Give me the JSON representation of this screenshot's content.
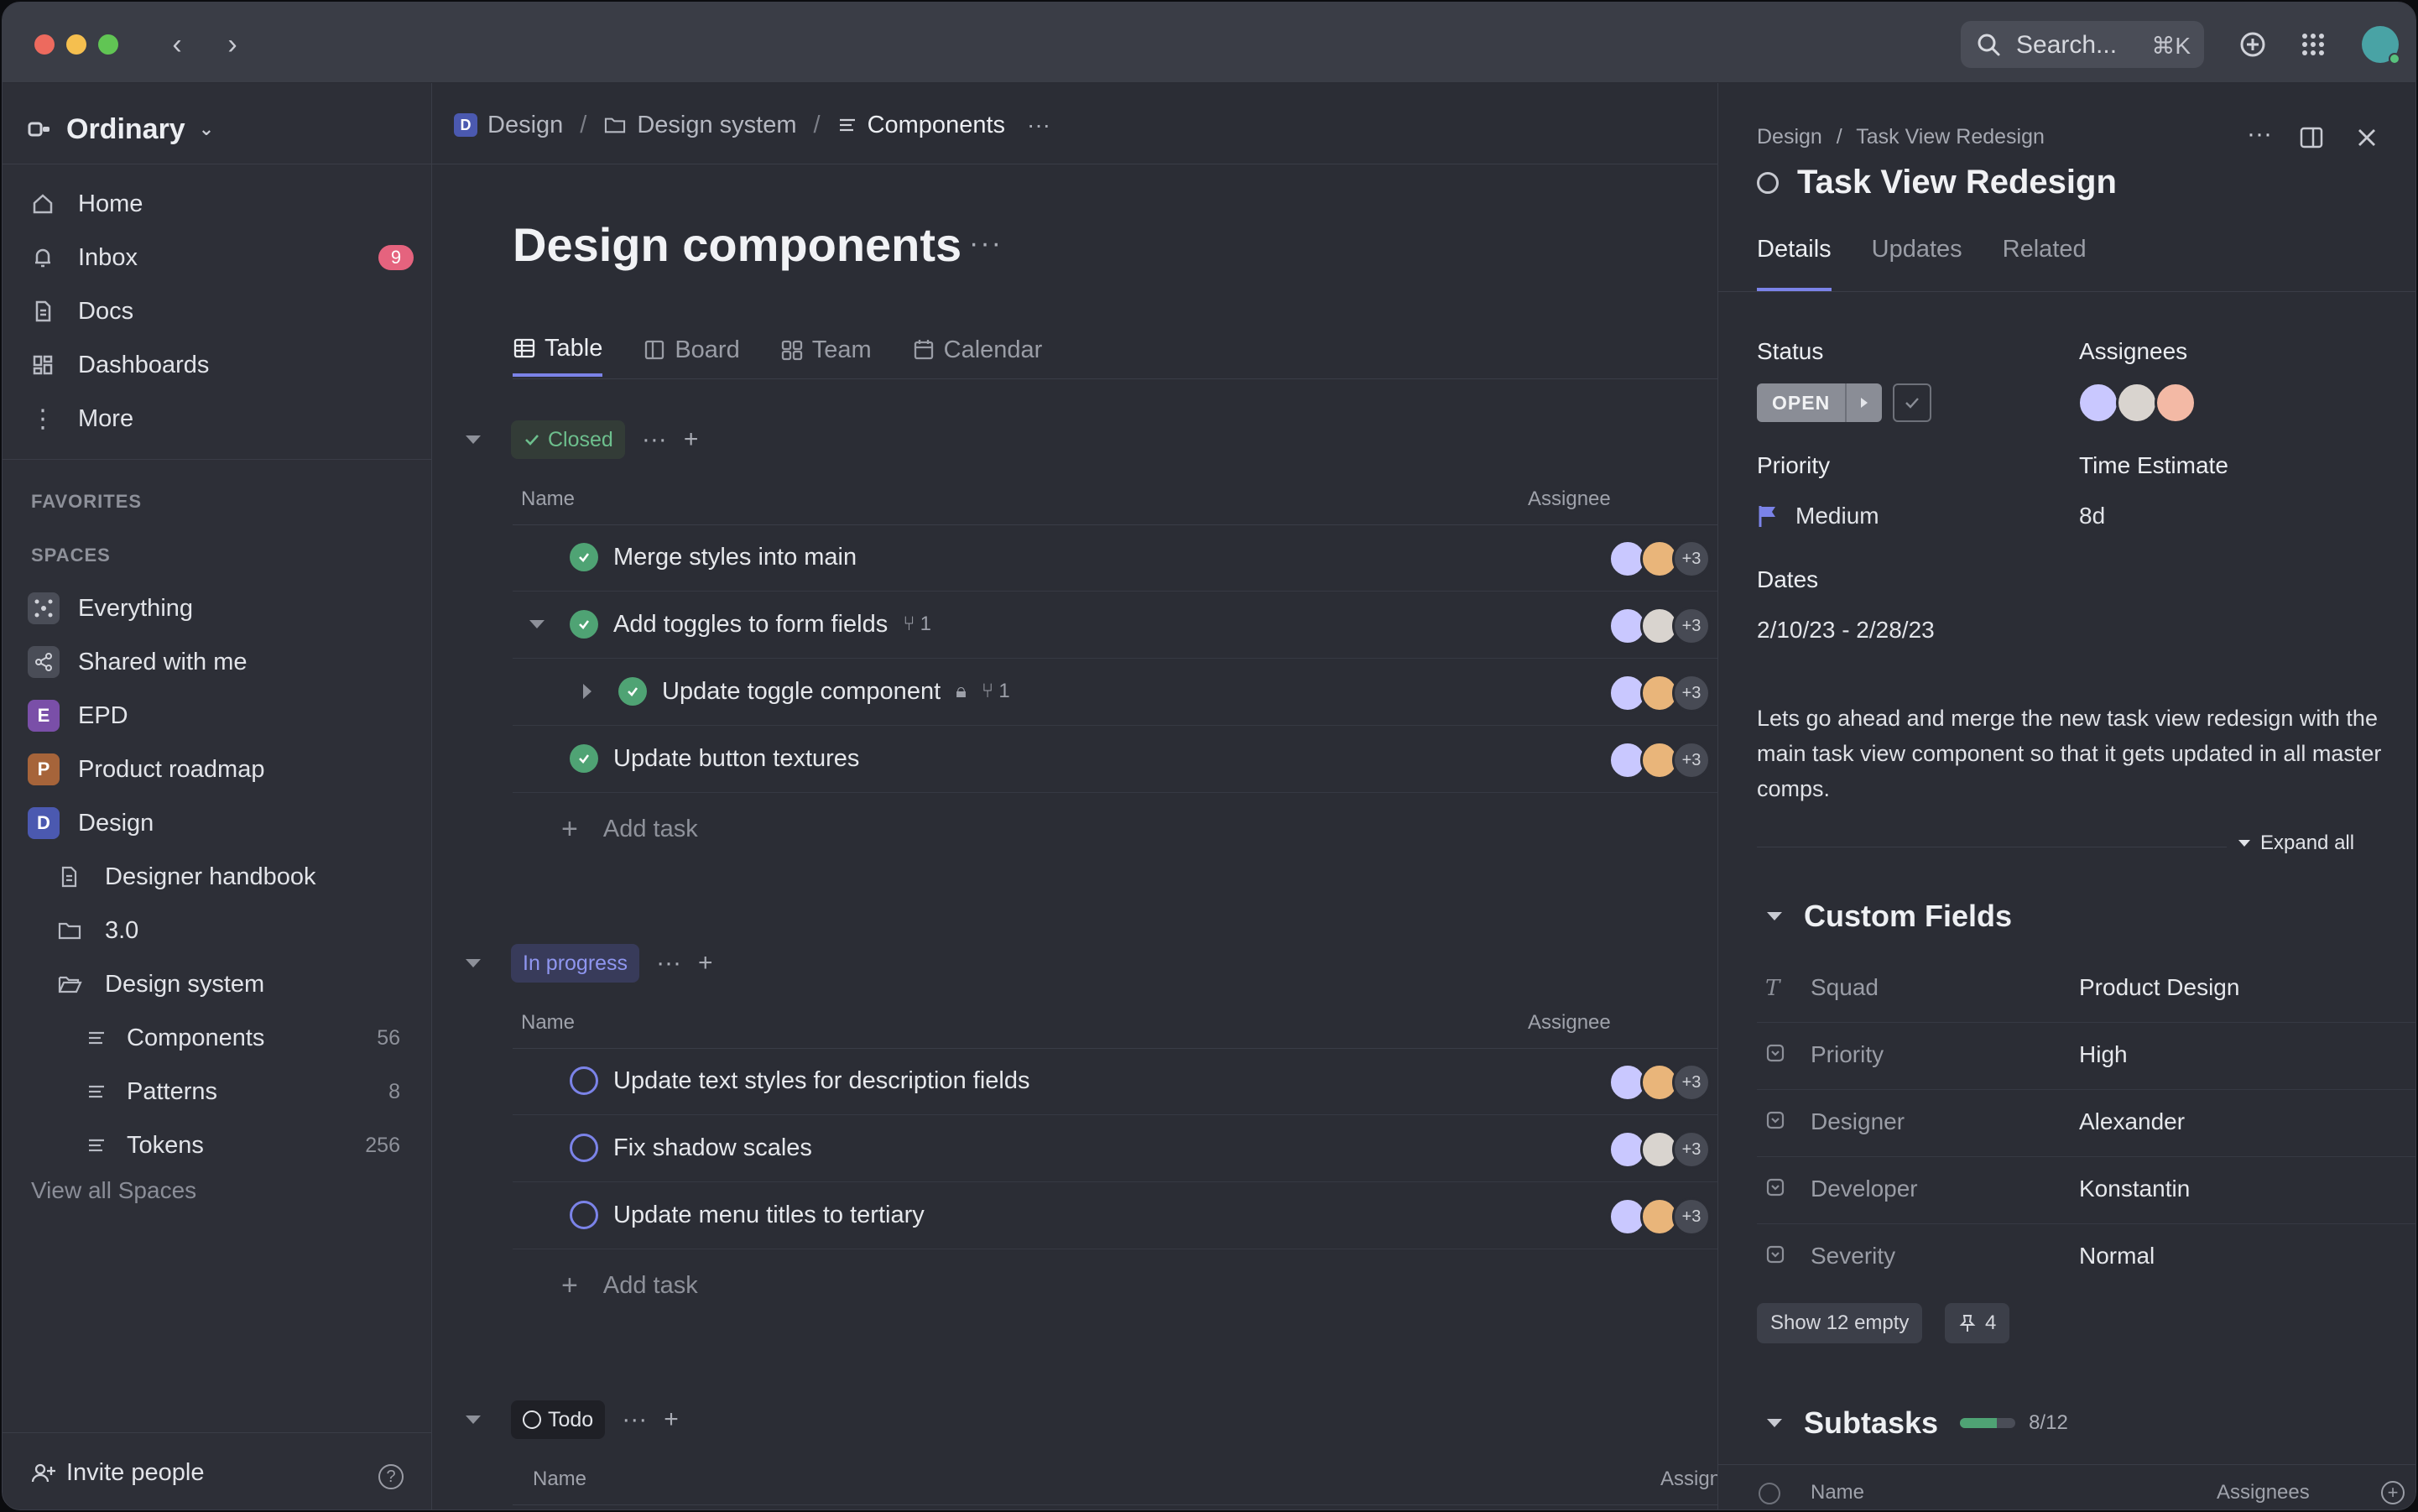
{
  "topbar": {
    "search_placeholder": "Search...",
    "search_shortcut": "⌘K"
  },
  "sidebar": {
    "workspace": "Ordinary",
    "nav": [
      {
        "label": "Home"
      },
      {
        "label": "Inbox",
        "badge": "9"
      },
      {
        "label": "Docs"
      },
      {
        "label": "Dashboards"
      },
      {
        "label": "More"
      }
    ],
    "favorites_label": "FAVORITES",
    "spaces_label": "SPACES",
    "spaces": [
      {
        "label": "Everything"
      },
      {
        "label": "Shared with me"
      },
      {
        "label": "EPD",
        "letter": "E",
        "color": "#7a4fa8"
      },
      {
        "label": "Product roadmap",
        "letter": "P",
        "color": "#a6643a"
      },
      {
        "label": "Design",
        "letter": "D",
        "color": "#4b59b0"
      }
    ],
    "design_children": [
      {
        "label": "Designer handbook"
      },
      {
        "label": "3.0"
      },
      {
        "label": "Design system"
      }
    ],
    "lists": [
      {
        "label": "Components",
        "count": "56"
      },
      {
        "label": "Patterns",
        "count": "8"
      },
      {
        "label": "Tokens",
        "count": "256"
      }
    ],
    "view_all": "View all Spaces",
    "invite": "Invite people"
  },
  "main": {
    "breadcrumb": [
      "Design",
      "Design system",
      "Components"
    ],
    "title": "Design components",
    "views": [
      "Table",
      "Board",
      "Team",
      "Calendar"
    ],
    "groups": {
      "closed": {
        "status": "Closed",
        "col_name": "Name",
        "col_assignee": "Assignee",
        "tasks": [
          {
            "name": "Merge styles into main"
          },
          {
            "name": "Add toggles to form fields",
            "subcount": "1"
          },
          {
            "name": "Update toggle component",
            "subcount": "1"
          },
          {
            "name": "Update button textures"
          }
        ],
        "add_task": "Add task"
      },
      "in_progress": {
        "status": "In progress",
        "col_name": "Name",
        "col_assignee": "Assignee",
        "tasks": [
          {
            "name": "Update text styles for description fields"
          },
          {
            "name": "Fix shadow scales"
          },
          {
            "name": "Update menu titles to tertiary"
          }
        ],
        "add_task": "Add task"
      },
      "todo": {
        "status": "Todo",
        "col_name": "Name",
        "col_assignee": "Assign"
      }
    },
    "assignee_more": "+3"
  },
  "panel": {
    "breadcrumb": [
      "Design",
      "Task View Redesign"
    ],
    "title": "Task View Redesign",
    "tabs": [
      "Details",
      "Updates",
      "Related"
    ],
    "status_label": "Status",
    "status_value": "OPEN",
    "assignees_label": "Assignees",
    "priority_label": "Priority",
    "priority_value": "Medium",
    "estimate_label": "Time Estimate",
    "estimate_value": "8d",
    "dates_label": "Dates",
    "dates_value": "2/10/23 - 2/28/23",
    "description": "Lets go ahead and merge the new task view redesign with the main task view component so that it gets updated in all master comps.",
    "expand_all": "Expand all",
    "custom_fields_title": "Custom Fields",
    "custom_fields": [
      {
        "key": "Squad",
        "value": "Product Design"
      },
      {
        "key": "Priority",
        "value": "High"
      },
      {
        "key": "Designer",
        "value": "Alexander"
      },
      {
        "key": "Developer",
        "value": "Konstantin"
      },
      {
        "key": "Severity",
        "value": "Normal"
      }
    ],
    "show_empty": "Show 12 empty",
    "pinned_count": "4",
    "subtasks_title": "Subtasks",
    "subtasks_progress": "8/12",
    "subtasks_fraction": 0.67,
    "subtasks_col_name": "Name",
    "subtasks_col_assignees": "Assignees"
  },
  "colors": {
    "accent": "#7b83e8",
    "done_green": "#4fa374",
    "badge_pink": "#e5637e"
  }
}
